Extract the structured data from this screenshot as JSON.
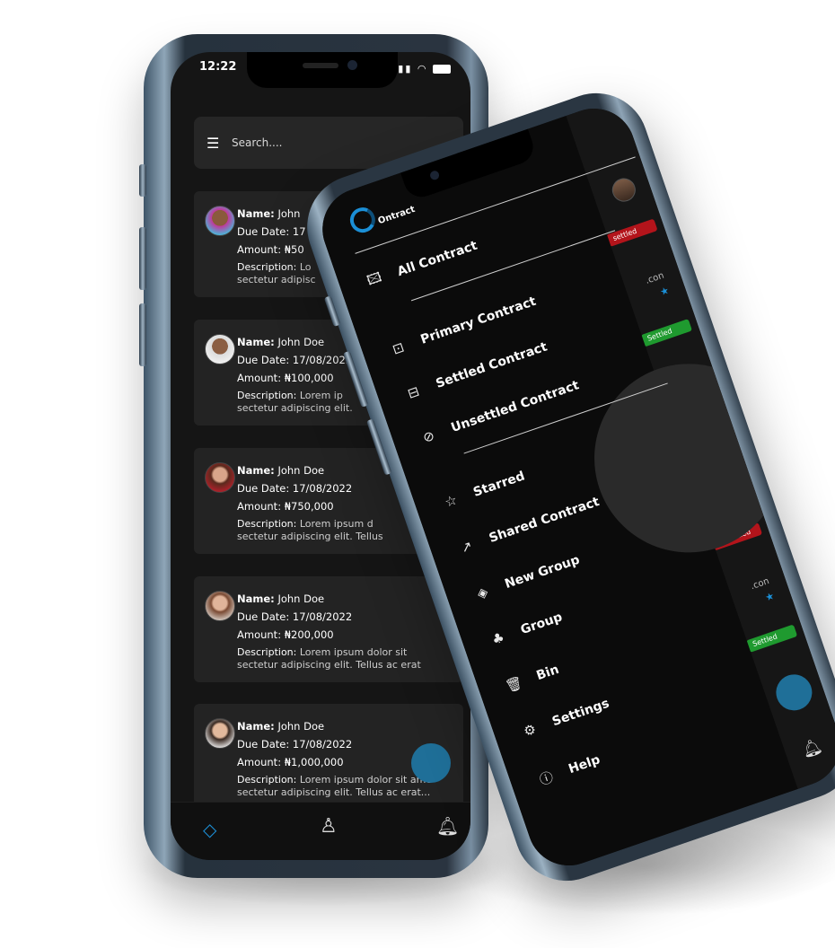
{
  "back_phone": {
    "status_time": "12:22",
    "search_placeholder": "Search....",
    "cards": [
      {
        "name_label": "Name:",
        "name": "John",
        "due_line": "Due Date: 17",
        "amount_line": "Amount: ₦50",
        "desc_label": "Description:",
        "desc_1": " Lo",
        "desc_2": "sectetur adipisc"
      },
      {
        "name_label": "Name:",
        "name": "John Doe",
        "due_line": "Due Date: 17/08/2022",
        "amount_line": "Amount: ₦100,000",
        "desc_label": "Description:",
        "desc_1": " Lorem ip",
        "desc_2": "sectetur adipiscing elit."
      },
      {
        "name_label": "Name:",
        "name": "John Doe",
        "due_line": "Due Date: 17/08/2022",
        "amount_line": "Amount: ₦750,000",
        "desc_label": "Description:",
        "desc_1": " Lorem ipsum d",
        "desc_2": "sectetur adipiscing elit. Tellus"
      },
      {
        "name_label": "Name:",
        "name": "John Doe",
        "due_line": "Due Date: 17/08/2022",
        "amount_line": "Amount: ₦200,000",
        "desc_label": "Description:",
        "desc_1": " Lorem ipsum dolor sit",
        "desc_2": "sectetur adipiscing elit. Tellus ac erat"
      },
      {
        "name_label": "Name:",
        "name": "John Doe",
        "due_line": "Due Date: 17/08/2022",
        "amount_line": "Amount: ₦1,000,000",
        "desc_label": "Description:",
        "desc_1": " Lorem ipsum dolor sit ame",
        "desc_2": "sectetur adipiscing elit. Tellus ac erat..."
      }
    ]
  },
  "front_phone": {
    "logo_text": "Ontract",
    "menu": [
      {
        "label": "All Contract",
        "icon": "image-icon"
      },
      {
        "label": "Primary Contract",
        "icon": "inbox-icon"
      },
      {
        "label": "Settled Contract",
        "icon": "cash-icon"
      },
      {
        "label": "Unsettled Contract",
        "icon": "cash-off-icon"
      },
      {
        "label": "Starred",
        "icon": "star-icon"
      },
      {
        "label": "Shared Contract",
        "icon": "share-icon"
      },
      {
        "label": "New Group",
        "icon": "layers-plus-icon"
      },
      {
        "label": "Group",
        "icon": "group-icon"
      },
      {
        "label": "Bin",
        "icon": "trash-icon"
      },
      {
        "label": "Settings",
        "icon": "gear-icon"
      },
      {
        "label": "Help",
        "icon": "help-icon"
      }
    ],
    "behind": {
      "tags": [
        "settled",
        "Settled",
        "settled",
        "Unsettled",
        "Settled"
      ],
      "con_text": ".con"
    }
  },
  "colors": {
    "accent": "#1b8fd6",
    "unsettled": "#b3141b",
    "settled": "#1f9a2f",
    "card_bg": "#232323"
  }
}
